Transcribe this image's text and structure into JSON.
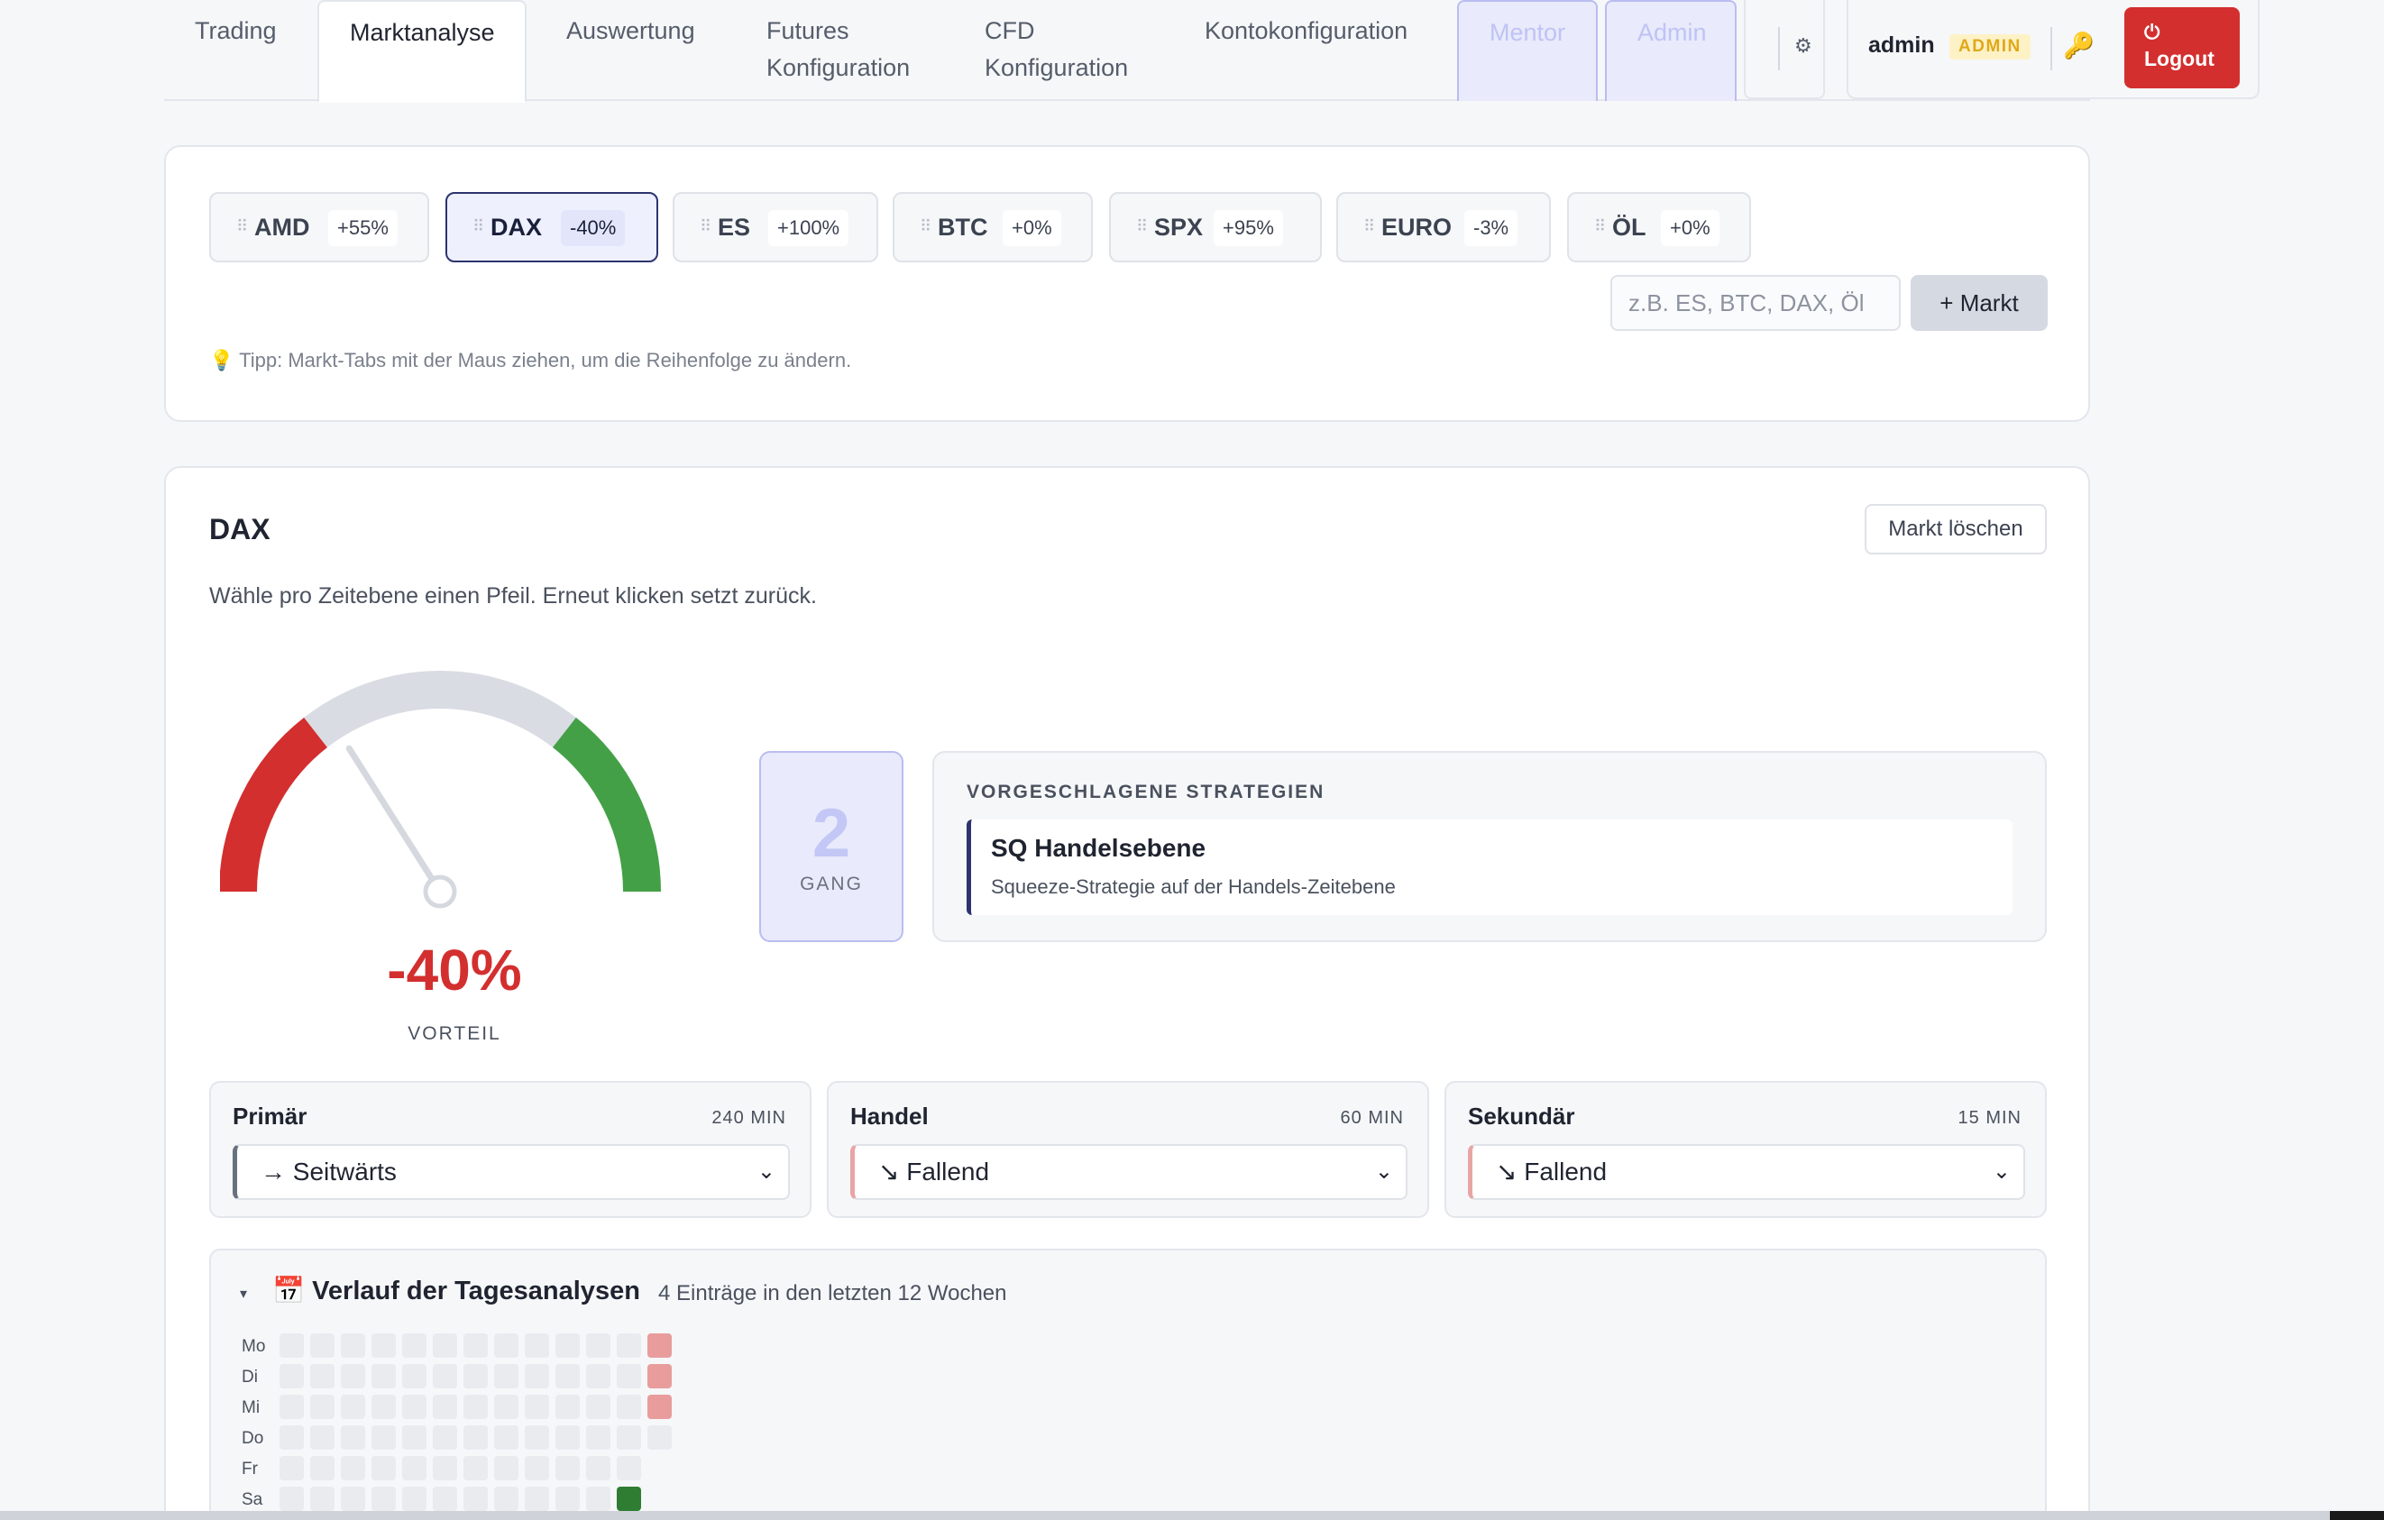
{
  "nav": {
    "tabs": [
      {
        "label": "Trading"
      },
      {
        "label": "Marktanalyse"
      },
      {
        "label": "Auswertung"
      },
      {
        "label": "Futures\nKonfiguration"
      },
      {
        "label": "CFD\nKonfiguration"
      },
      {
        "label": "Kontokonfiguration"
      },
      {
        "label": "Mentor"
      },
      {
        "label": "Admin"
      }
    ],
    "settings_icon": "gear-icon",
    "user": {
      "name": "admin",
      "role": "ADMIN",
      "key_icon": "key-icon"
    },
    "logout_label": "Logout",
    "logout_icon": "power-icon"
  },
  "markets": {
    "tabs": [
      {
        "name": "AMD",
        "pct": "+55%"
      },
      {
        "name": "DAX",
        "pct": "-40%",
        "selected": true
      },
      {
        "name": "ES",
        "pct": "+100%"
      },
      {
        "name": "BTC",
        "pct": "+0%"
      },
      {
        "name": "SPX",
        "pct": "+95%"
      },
      {
        "name": "EURO",
        "pct": "-3%"
      },
      {
        "name": "ÖL",
        "pct": "+0%"
      }
    ],
    "input_placeholder": "z.B. ES, BTC, DAX, Öl",
    "add_label": "+ Markt",
    "tip": "💡 Tipp: Markt-Tabs mit der Maus ziehen, um die Reihenfolge zu ändern."
  },
  "detail": {
    "title": "DAX",
    "delete_label": "Markt löschen",
    "hint": "Wähle pro Zeitebene einen Pfeil. Erneut klicken setzt zurück.",
    "gauge": {
      "value": -40,
      "value_label": "-40%",
      "label": "VORTEIL"
    },
    "gang": {
      "number": "2",
      "label": "GANG"
    },
    "strategies": {
      "heading": "VORGESCHLAGENE STRATEGIEN",
      "items": [
        {
          "name": "SQ Handelsebene",
          "desc": "Squeeze-Strategie auf der Handels-Zeitebene"
        }
      ]
    },
    "timeframes": [
      {
        "name": "Primär",
        "minutes": "240 MIN",
        "value": "→ Seitwärts",
        "trend": "neutral"
      },
      {
        "name": "Handel",
        "minutes": "60 MIN",
        "value": "↘ Fallend",
        "trend": "bear"
      },
      {
        "name": "Sekundär",
        "minutes": "15 MIN",
        "value": "↘ Fallend",
        "trend": "bear"
      }
    ],
    "history": {
      "toggle": "▾",
      "title": "📅 Verlauf der Tagesanalysen",
      "subtitle": "4 Einträge in den letzten 12 Wochen",
      "days": [
        "Mo",
        "Di",
        "Mi",
        "Do",
        "Fr",
        "Sa"
      ],
      "entries": [
        {
          "day": "Mo",
          "week": 13,
          "trend": "bear"
        },
        {
          "day": "Di",
          "week": 13,
          "trend": "bear"
        },
        {
          "day": "Mi",
          "week": 13,
          "trend": "bear"
        },
        {
          "day": "Sa",
          "week": 12,
          "trend": "bull"
        }
      ]
    }
  },
  "colors": {
    "bear": "#d32f2f",
    "bull": "#43a047",
    "neutral": "#d9dce3",
    "accent": "#2c3470"
  }
}
